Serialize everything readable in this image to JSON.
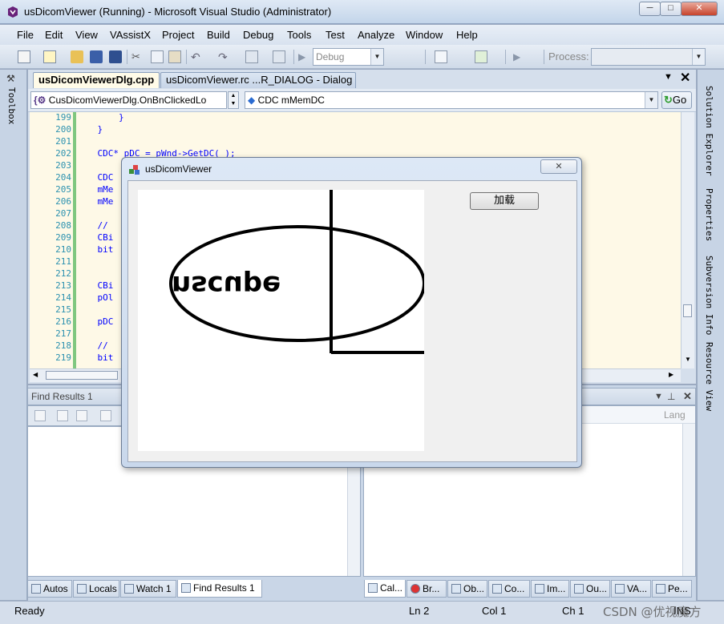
{
  "window": {
    "title": "usDicomViewer (Running) - Microsoft Visual Studio (Administrator)",
    "minimize": "─",
    "restore": "□",
    "close": "✕"
  },
  "menu": [
    "File",
    "Edit",
    "View",
    "VAssistX",
    "Project",
    "Build",
    "Debug",
    "Tools",
    "Test",
    "Analyze",
    "Window",
    "Help"
  ],
  "toolbar": {
    "config": "Debug",
    "process_label": "Process:",
    "process_value": ""
  },
  "left_strip": {
    "toolbox": "Toolbox"
  },
  "right_strip": {
    "solution_explorer": "Solution Explorer",
    "properties": "Properties",
    "subversion": "Subversion Info",
    "resource_view": "Resource View"
  },
  "editor": {
    "tabs": [
      {
        "label": "usDicomViewerDlg.cpp",
        "active": true
      },
      {
        "label": "usDicomViewer.rc ...R_DIALOG - Dialog",
        "active": false
      }
    ],
    "nav_left": "CusDicomViewerDlg.OnBnClickedLo",
    "nav_right": "CDC mMemDC",
    "go": "Go",
    "lines": [
      {
        "num": "199",
        "code": "        }"
      },
      {
        "num": "200",
        "code": "    }"
      },
      {
        "num": "201",
        "code": ""
      },
      {
        "num": "202",
        "code": "    CDC* pDC = pWnd->GetDC( );"
      },
      {
        "num": "203",
        "code": ""
      },
      {
        "num": "204",
        "code": "    CDC"
      },
      {
        "num": "205",
        "code": "    mMe"
      },
      {
        "num": "206",
        "code": "    mMe"
      },
      {
        "num": "207",
        "code": ""
      },
      {
        "num": "208",
        "code": "    //"
      },
      {
        "num": "209",
        "code": "    CBi"
      },
      {
        "num": "210",
        "code": "    bit"
      },
      {
        "num": "211",
        "code": ""
      },
      {
        "num": "212",
        "code": ""
      },
      {
        "num": "213",
        "code": "    CBi"
      },
      {
        "num": "214",
        "code": "    pOl"
      },
      {
        "num": "215",
        "code": ""
      },
      {
        "num": "216",
        "code": "    pDC"
      },
      {
        "num": "217",
        "code": ""
      },
      {
        "num": "218",
        "code": "    //"
      },
      {
        "num": "219",
        "code": "    bit"
      }
    ]
  },
  "find_results": {
    "title": "Find Results 1"
  },
  "right_panel": {
    "column_header": "Lang"
  },
  "bottom_tabs_left": [
    "Autos",
    "Locals",
    "Watch 1",
    "Find Results 1"
  ],
  "bottom_tabs_right": [
    "Cal...",
    "Br...",
    "Ob...",
    "Co...",
    "Im...",
    "Ou...",
    "VA...",
    "Pe..."
  ],
  "status": {
    "ready": "Ready",
    "ln": "Ln 2",
    "col": "Col 1",
    "ch": "Ch 1",
    "ins": "INS",
    "watermark": "CSDN @优视魔方"
  },
  "dialog": {
    "title": "usDicomViewer",
    "close": "✕",
    "load_button": "加载",
    "image_text": "nscupe"
  }
}
